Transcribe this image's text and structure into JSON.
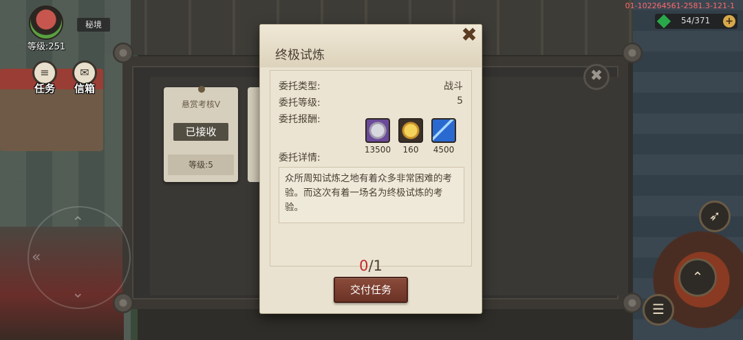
{
  "hud": {
    "level_text": "等级:251",
    "area_label": "秘境",
    "task_label": "任务",
    "mail_label": "信箱",
    "build_id": "01-102264561-2581.3-121-1",
    "gems": "54/371",
    "gem_plus": "+"
  },
  "board": {
    "close_symbol": "✖",
    "mission_card": {
      "title": "悬赏考核Ⅴ",
      "status": "已接收",
      "level": "等级:5"
    }
  },
  "dialog": {
    "title": "终极试炼",
    "close_symbol": "✖",
    "type_label": "委托类型:",
    "type_value": "战斗",
    "level_label": "委托等级:",
    "level_value": "5",
    "reward_label": "委托报酬:",
    "rewards": [
      {
        "icon": "silver-coin-icon",
        "amount": "13500"
      },
      {
        "icon": "gold-coin-icon",
        "amount": "160"
      },
      {
        "icon": "ticket-icon",
        "amount": "4500"
      }
    ],
    "detail_label": "委托详情:",
    "detail_text": "众所周知试炼之地有着众多非常困难的考验。而这次有着一场名为终极试炼的考验。",
    "progress_current": "0",
    "progress_total": "/1",
    "submit_label": "交付任务"
  },
  "colors": {
    "dialog_bg": "#e9e2d0",
    "submit_bg": "#7a3e30",
    "progress_current": "#c3292a",
    "build_id": "#ff6b6b"
  }
}
